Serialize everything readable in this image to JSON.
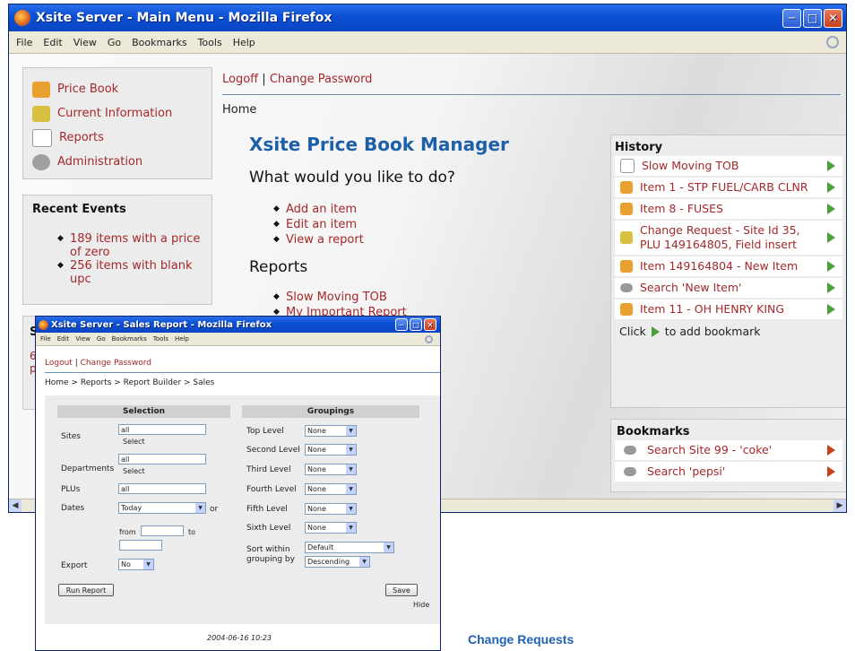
{
  "main_window": {
    "title": "Xsite Server - Main Menu - Mozilla Firefox",
    "menu": [
      "File",
      "Edit",
      "View",
      "Go",
      "Bookmarks",
      "Tools",
      "Help"
    ],
    "nav": [
      "Price Book",
      "Current Information",
      "Reports",
      "Administration"
    ],
    "recent_events": {
      "heading": "Recent Events",
      "items": [
        "189 items with a price of zero",
        "256 items with blank upc"
      ]
    },
    "partial_box": {
      "heading": "St",
      "lines": [
        "6",
        "pr"
      ]
    },
    "logoff": "Logoff",
    "separator": "|",
    "change_password": "Change Password",
    "breadcrumb": "Home",
    "heading": "Xsite Price Book Manager",
    "question": "What would you like to do?",
    "actions": [
      "Add an item",
      "Edit an item",
      "View a report"
    ],
    "reports_heading": "Reports",
    "reports": [
      "Slow Moving TOB",
      "My Important Report"
    ],
    "history": {
      "heading": "History",
      "items": [
        "Slow Moving TOB",
        "Item 1 - STP FUEL/CARB CLNR",
        "Item 8 - FUSES",
        "Change Request - Site Id 35, PLU 149164805, Field insert",
        "Item 149164804 - New Item",
        "Search 'New Item'",
        "Item 11 - OH HENRY KING"
      ],
      "hint_click": "Click",
      "hint_rest": "to add bookmark"
    },
    "bookmarks": {
      "heading": "Bookmarks",
      "items": [
        "Search Site 99 - 'coke'",
        "Search 'pepsi'"
      ]
    }
  },
  "popup": {
    "title": "Xsite Server - Sales Report - Mozilla Firefox",
    "menu": [
      "File",
      "Edit",
      "View",
      "Go",
      "Bookmarks",
      "Tools",
      "Help"
    ],
    "logout": "Logout",
    "separator": "|",
    "change_password": "Change Password",
    "breadcrumb": "Home > Reports > Report Builder > Sales",
    "selection_heading": "Selection",
    "groupings_heading": "Groupings",
    "sites_label": "Sites",
    "sites_value": "all",
    "sites_link": "Select",
    "departments_label": "Departments",
    "departments_value": "all",
    "departments_link": "Select",
    "plus_label": "PLUs",
    "plus_value": "all",
    "dates_label": "Dates",
    "dates_value": "Today",
    "or_text": "or",
    "from_text": "from",
    "to_text": "to",
    "export_label": "Export",
    "export_value": "No",
    "levels": [
      {
        "label": "Top Level",
        "value": "None"
      },
      {
        "label": "Second Level",
        "value": "None"
      },
      {
        "label": "Third Level",
        "value": "None"
      },
      {
        "label": "Fourth Level",
        "value": "None"
      },
      {
        "label": "Fifth Level",
        "value": "None"
      },
      {
        "label": "Sixth Level",
        "value": "None"
      }
    ],
    "sort_label": "Sort within grouping by",
    "sort_value": "Default",
    "sort_order": "Descending",
    "run_button": "Run Report",
    "save_button": "Save",
    "hide_link": "Hide",
    "timestamp": "2004-06-16 10:23"
  },
  "caption": "Change Requests",
  "colors": {
    "link": "#a5282a",
    "heading_blue": "#1d5fa8",
    "titlebar": "#0a4fd4"
  }
}
